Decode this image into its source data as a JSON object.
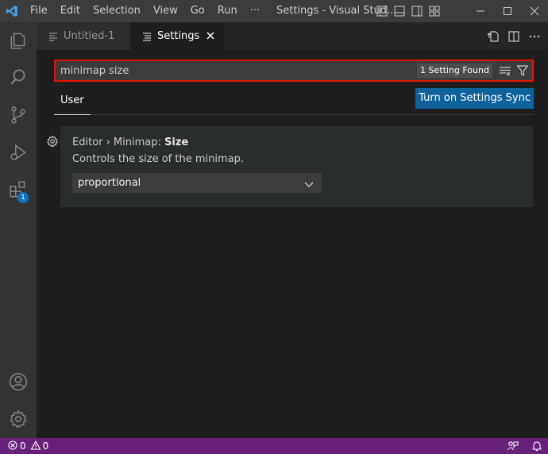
{
  "titlebar": {
    "menu": [
      "File",
      "Edit",
      "Selection",
      "View",
      "Go",
      "Run",
      "···"
    ],
    "title": "Settings - Visual Stud..."
  },
  "activitybar": {
    "extensions_badge": "1"
  },
  "tabs": [
    {
      "label": "Untitled-1",
      "active": false
    },
    {
      "label": "Settings",
      "active": true
    }
  ],
  "search": {
    "value": "minimap size",
    "result_count": "1 Setting Found"
  },
  "scope": {
    "user_tab": "User",
    "sync_button": "Turn on Settings Sync"
  },
  "setting": {
    "category": "Editor › Minimap: ",
    "name": "Size",
    "description": "Controls the size of the minimap.",
    "value": "proportional"
  },
  "statusbar": {
    "errors": "0",
    "warnings": "0"
  },
  "colors": {
    "statusbar": "#68217a",
    "accent_button": "#0e639c",
    "search_highlight": "#e51400",
    "badge": "#0e70c0"
  }
}
